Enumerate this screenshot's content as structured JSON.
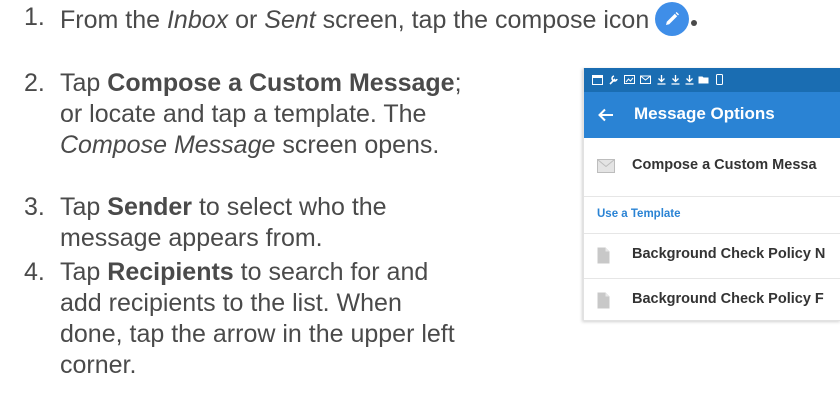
{
  "steps": [
    {
      "number": "1.",
      "parts": [
        "From the ",
        "Inbox",
        " or ",
        "Sent",
        " screen, tap the compose icon"
      ]
    },
    {
      "number": "2.",
      "parts": [
        "Tap ",
        "Compose a Custom Message",
        ";",
        "or locate and tap a template. The",
        "Compose Message",
        " screen opens."
      ]
    },
    {
      "number": "3.",
      "parts": [
        "Tap ",
        "Sender",
        " to select who the",
        "message appears from."
      ]
    },
    {
      "number": "4.",
      "parts": [
        "Tap ",
        "Recipients",
        " to search for and",
        "add recipients to the list. When",
        "done, tap the arrow in the upper left",
        "corner."
      ]
    }
  ],
  "phone": {
    "title": "Message Options",
    "compose_row": "Compose a Custom Messa",
    "section_header": "Use a Template",
    "templates": [
      "Background Check Policy N",
      "Background Check Policy F"
    ]
  },
  "colors": {
    "statusbar": "#1a6db2",
    "appbar": "#2a83d4",
    "compose_icon": "#3f8ee8",
    "section_label": "#2a83d4"
  },
  "icons": {
    "compose": "pencil-icon",
    "back": "arrow-left-icon",
    "envelope": "envelope-icon",
    "document": "document-icon"
  }
}
